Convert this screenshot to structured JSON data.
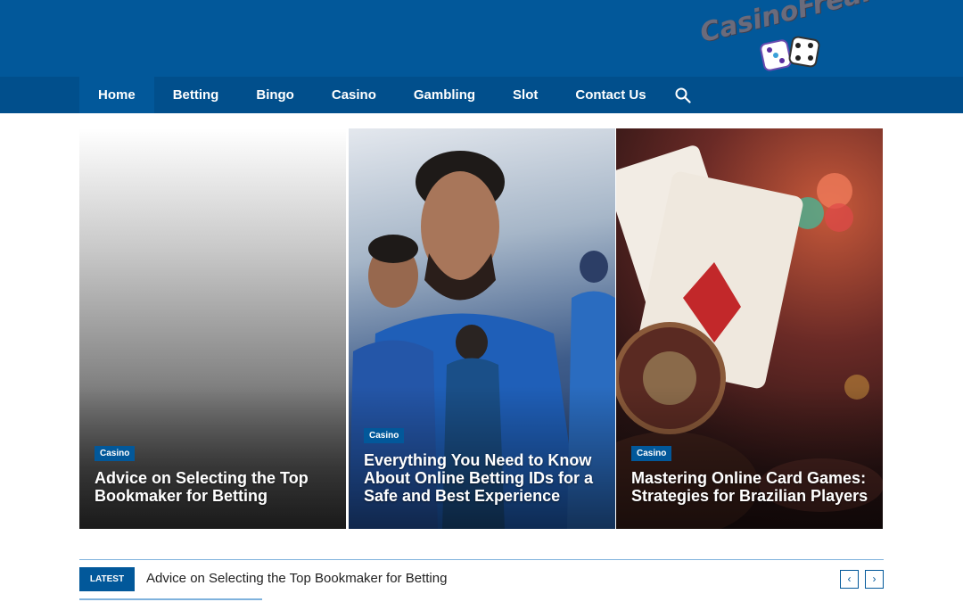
{
  "brand": {
    "logo_text": "CasinoFreakers"
  },
  "nav": {
    "items": [
      {
        "label": "Home",
        "active": true
      },
      {
        "label": "Betting"
      },
      {
        "label": "Bingo"
      },
      {
        "label": "Casino"
      },
      {
        "label": "Gambling"
      },
      {
        "label": "Slot"
      },
      {
        "label": "Contact Us"
      }
    ],
    "search_icon": "search-icon"
  },
  "featured": [
    {
      "category": "Casino",
      "title": "Advice on Selecting the Top Bookmaker for Betting"
    },
    {
      "category": "Casino",
      "title": "Everything You Need to Know About Online Betting IDs for a Safe and Best Experience"
    },
    {
      "category": "Casino",
      "title": "Mastering Online Card Games: Strategies for Brazilian Players"
    }
  ],
  "ticker": {
    "label": "LATEST",
    "headline": "Advice on Selecting the Top Bookmaker for Betting",
    "prev": "‹",
    "next": "›"
  },
  "colors": {
    "primary": "#02589a",
    "nav": "#014f8c",
    "accent_line": "#7fb2dd"
  }
}
